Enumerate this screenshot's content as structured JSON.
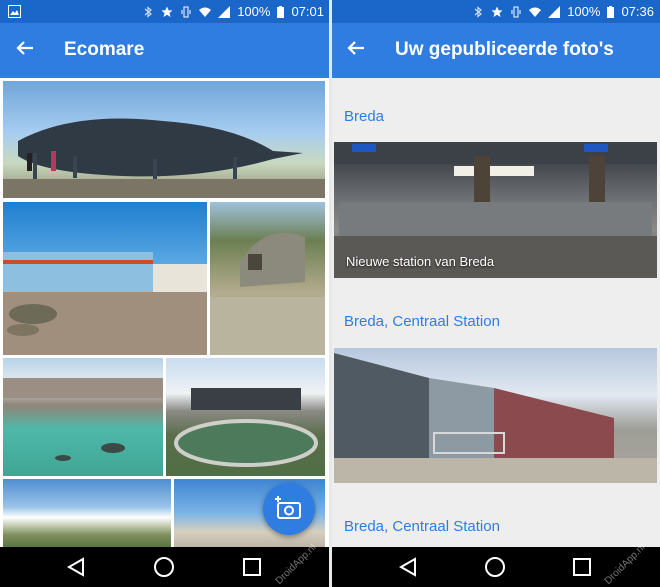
{
  "left": {
    "status": {
      "battery": "100%",
      "time": "07:01"
    },
    "title": "Ecomare",
    "photos": [
      "whale-skeleton-photo",
      "ecomare-building-photo",
      "wooden-hut-dunes-photo",
      "seal-pool-photo",
      "seal-basin-building-photo",
      "dune-landscape-photo",
      "beach-huts-photo"
    ],
    "fab_icon": "add-photo-icon"
  },
  "right": {
    "status": {
      "battery": "100%",
      "time": "07:36"
    },
    "title": "Uw gepubliceerde foto's",
    "sections": [
      {
        "title": "Breda",
        "caption": "Nieuwe station van Breda"
      },
      {
        "title": "Breda, Centraal Station",
        "caption": ""
      },
      {
        "title": "Breda, Centraal Station",
        "caption": ""
      }
    ]
  },
  "watermark": "DroidApp.nl",
  "colors": {
    "status_bar": "#1a66c9",
    "app_bar": "#2f7de1",
    "accent": "#2f7de1"
  }
}
